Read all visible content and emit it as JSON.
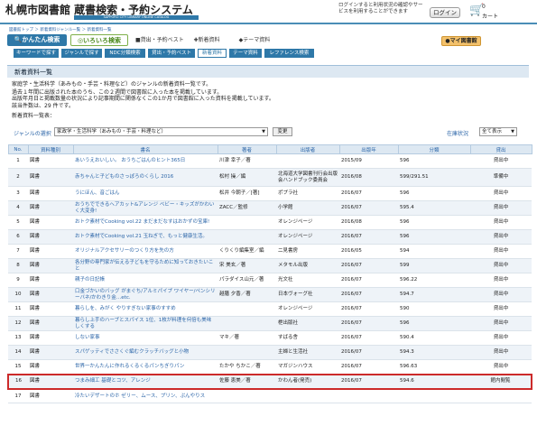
{
  "header": {
    "logo": "札幌市図書館 蔵書検索・予約システム",
    "logo_sub": "SAPPORO CITY LIBRARY ONLINE CATALOG",
    "login_msg": "ログインすると利用状況の確認やサービスを利用することができます",
    "login_label": "ログイン",
    "cart_label": "カート",
    "cart_count": "0"
  },
  "breadcrumb": "図書館トップ ＞ 新着資料ジャンル一覧 ＞ 新着資料一覧",
  "tabs": {
    "simple": "かんたん検索",
    "various": "いろいろ検索",
    "lend": "貸出・予約ベスト",
    "new": "新着資料",
    "theme": "テーマ資料",
    "mylib": "マイ図書館"
  },
  "subnav": [
    "キーワードで探す",
    "ジャンルで探す",
    "NDC分類検索",
    "貸出・予約ベスト",
    "新着資料",
    "テーマ資料",
    "レファレンス検索"
  ],
  "page_title": "新着資料一覧",
  "info_lines": [
    "家庭学・生活科学（あみもの・手芸・料理など）のジャンルの新着資料一覧です。",
    "過去１年間に出版された本のうち、この２週間で図書館に入った本を掲載しています。",
    "出版年月日と掲載数量の状況により記事期間に関係なくこの1か月で図書館に入った資料を掲載しています。",
    "該当件数は、29 件です。"
  ],
  "list_title": "新着資料一覧表：",
  "genre_label": "ジャンルの選択",
  "genre_value": "家政学・生活科学（あみもの・手芸・料理など）",
  "change_btn": "変更",
  "status_label": "在庫状況",
  "status_value": "全て表示",
  "columns": [
    "No.",
    "資料種別",
    "書名",
    "著者",
    "出版者",
    "出版年",
    "分類",
    "貸出"
  ],
  "rows": [
    {
      "no": "1",
      "type": "図書",
      "title": "あいうえおいしい。 おうちごはんのヒント365日",
      "author": "川津 幸子／著",
      "pub": "",
      "year": "2015/09",
      "cls": "596",
      "st": "貸出中"
    },
    {
      "no": "2",
      "type": "図書",
      "title": "赤ちゃんと子どものさっぽろのくらし 2016",
      "author": "松村 操／編",
      "pub": "北海道大学図書刊行会出版会ハンドブック委員会",
      "year": "2016/08",
      "cls": "599/291.51",
      "st": "準備中"
    },
    {
      "no": "3",
      "type": "図書",
      "title": "うにほん、音ごはん",
      "author": "松井 今朝子／[著]",
      "pub": "ポプラ社",
      "year": "2016/07",
      "cls": "596",
      "st": "貸出中"
    },
    {
      "no": "4",
      "type": "図書",
      "title": "おうちでできるヘアカット&アレンジ ベビー・キッズがかわいく大変身!",
      "author": "ZACC／監修",
      "pub": "小学館",
      "year": "2016/07",
      "cls": "595.4",
      "st": "貸出中"
    },
    {
      "no": "5",
      "type": "図書",
      "title": "おトク素材でCooking vol.22 まだまだなすはおかずの宝庫!",
      "author": "",
      "pub": "オレンジページ",
      "year": "2016/08",
      "cls": "596",
      "st": "貸出中"
    },
    {
      "no": "6",
      "type": "図書",
      "title": "おトク素材でCooking vol.21 玉ねぎで、もっと健康生活。",
      "author": "",
      "pub": "オレンジページ",
      "year": "2016/07",
      "cls": "596",
      "st": "貸出中"
    },
    {
      "no": "7",
      "type": "図書",
      "title": "オリジナルアクセサリーのつくり方を先の方",
      "author": "くりくり編集室／編",
      "pub": "二見書房",
      "year": "2016/05",
      "cls": "594",
      "st": "貸出中"
    },
    {
      "no": "8",
      "type": "図書",
      "title": "各分野の専門家が伝える子どもを守るために知っておきたいこと",
      "author": "宋 美玄／著",
      "pub": "メタモル出版",
      "year": "2016/07",
      "cls": "599",
      "st": "貸出中"
    },
    {
      "no": "9",
      "type": "図書",
      "title": "親子の日記帳",
      "author": "パラダイス山元／著",
      "pub": "光文社",
      "year": "2016/07",
      "cls": "596.22",
      "st": "貸出中"
    },
    {
      "no": "10",
      "type": "図書",
      "title": "口金づかいのバッグ がまぐち/アルミパイプ ワイヤー/ペンシリーバネ/かわきり金…etc.",
      "author": "越膳 夕香／著",
      "pub": "日本ヴォーグ社",
      "year": "2016/07",
      "cls": "594.7",
      "st": "貸出中"
    },
    {
      "no": "11",
      "type": "図書",
      "title": "暮らしを、みがく やりすぎない家事のすすめ",
      "author": "",
      "pub": "オレンジページ",
      "year": "2016/07",
      "cls": "590",
      "st": "貸出中"
    },
    {
      "no": "12",
      "type": "図書",
      "title": "暮らし上手のハーブとスパイス 1位、1枚が料理を何倍も美味しくする",
      "author": "",
      "pub": "枻出版社",
      "year": "2016/07",
      "cls": "596",
      "st": "貸出中"
    },
    {
      "no": "13",
      "type": "図書",
      "title": "しない家事",
      "author": "マキ／著",
      "pub": "すばる舎",
      "year": "2016/07",
      "cls": "590.4",
      "st": "貸出中"
    },
    {
      "no": "14",
      "type": "図書",
      "title": "スパゲッティでささくぐ編むクラッチバッグと小物",
      "author": "",
      "pub": "主婦と生活社",
      "year": "2016/07",
      "cls": "594.3",
      "st": "貸出中"
    },
    {
      "no": "15",
      "type": "図書",
      "title": "世界一かんたんに作れるくるくるパンちぎりパン",
      "author": "たかや ちかこ／著",
      "pub": "マガジンハウス",
      "year": "2016/07",
      "cls": "596.63",
      "st": "貸出中"
    },
    {
      "no": "16",
      "type": "図書",
      "title": "つまみ細工 基礎とコツ、アレンジ",
      "author": "佐藤 恵美／著",
      "pub": "かわん者(発売)",
      "year": "2016/07",
      "cls": "594.6",
      "st": "館内閲覧"
    },
    {
      "no": "17",
      "type": "図書",
      "title": "冷たいデザートのホ ゼリー、ムース、プリン、ぷんやりス",
      "author": "",
      "pub": "",
      "year": "",
      "cls": "",
      "st": ""
    }
  ]
}
